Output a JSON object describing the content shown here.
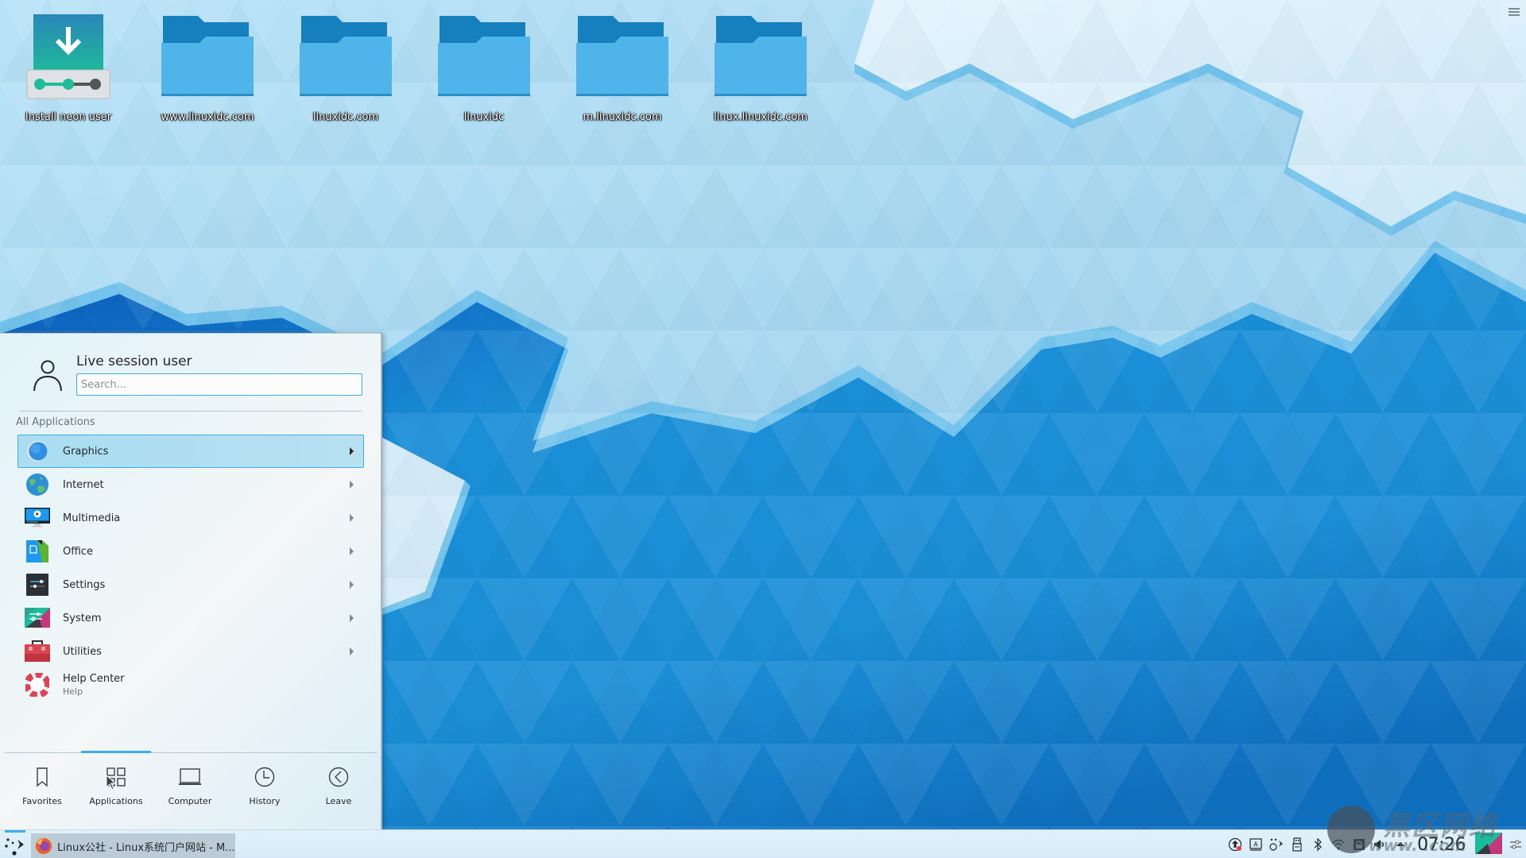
{
  "desktop": {
    "icons": [
      {
        "label": "Install neon user",
        "type": "installer"
      },
      {
        "label": "www.linuxidc.com",
        "type": "folder"
      },
      {
        "label": "linuxidc.com",
        "type": "folder"
      },
      {
        "label": "linuxidc",
        "type": "folder"
      },
      {
        "label": "m.linuxidc.com",
        "type": "folder"
      },
      {
        "label": "linux.linuxidc.com",
        "type": "folder"
      }
    ],
    "menu_icon": "hamburger-icon"
  },
  "launcher": {
    "user_name": "Live session user",
    "search": {
      "placeholder": "Search...",
      "value": ""
    },
    "section_title": "All Applications",
    "apps": [
      {
        "label": "Graphics",
        "icon": "graphics-icon",
        "has_submenu": true,
        "active": true
      },
      {
        "label": "Internet",
        "icon": "internet-icon",
        "has_submenu": true
      },
      {
        "label": "Multimedia",
        "icon": "multimedia-icon",
        "has_submenu": true
      },
      {
        "label": "Office",
        "icon": "office-icon",
        "has_submenu": true
      },
      {
        "label": "Settings",
        "icon": "settings-icon",
        "has_submenu": true
      },
      {
        "label": "System",
        "icon": "system-icon",
        "has_submenu": true
      },
      {
        "label": "Utilities",
        "icon": "utilities-icon",
        "has_submenu": true
      },
      {
        "label": "Help Center",
        "sublabel": "Help",
        "icon": "help-icon",
        "has_submenu": false
      }
    ],
    "tabs": [
      {
        "label": "Favorites",
        "icon": "bookmark-icon"
      },
      {
        "label": "Applications",
        "icon": "applications-grid-icon",
        "selected": true
      },
      {
        "label": "Computer",
        "icon": "laptop-icon"
      },
      {
        "label": "History",
        "icon": "clock-icon"
      },
      {
        "label": "Leave",
        "icon": "back-circle-icon"
      }
    ]
  },
  "taskbar": {
    "start_icon": "kickoff-icon",
    "tasks": [
      {
        "label": "Linux公社 - Linux系统门户网站 - M...",
        "icon": "firefox-icon"
      }
    ],
    "tray": [
      "update-icon",
      "input-method-icon",
      "kde-connect-icon",
      "usb-device-icon",
      "bluetooth-icon",
      "wifi-icon",
      "lock-icon",
      "volume-icon",
      "expand-tray-icon"
    ],
    "clock": "07:26",
    "colors": {
      "accent": "#3daee9",
      "update_badge": "#e93a4a"
    }
  },
  "watermark": {
    "text": "黑区网络",
    "url": "www.      .com"
  }
}
